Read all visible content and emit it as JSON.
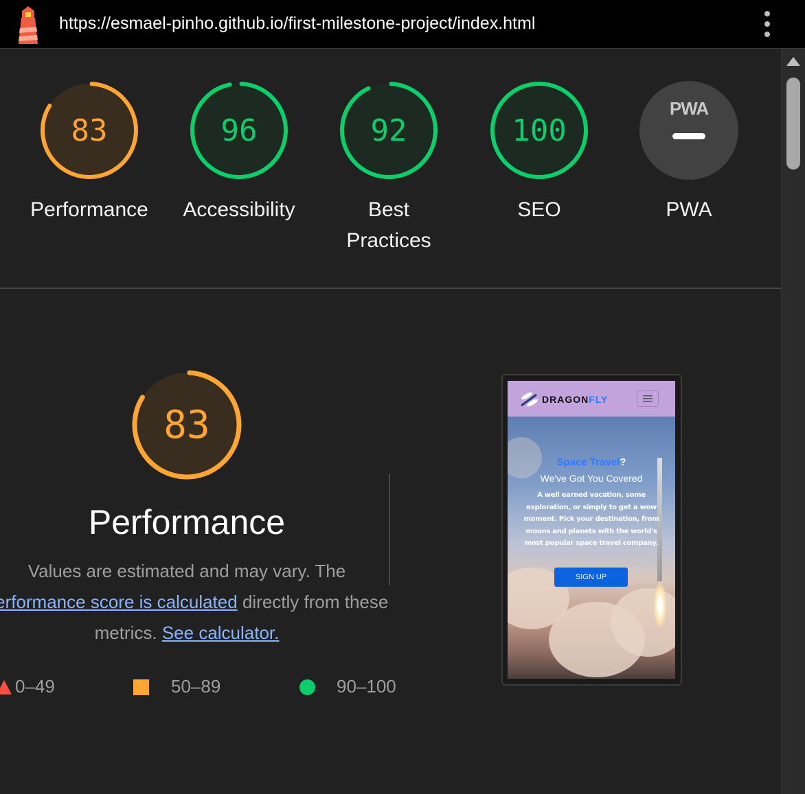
{
  "topbar": {
    "url": "https://esmael-pinho.github.io/first-milestone-project/index.html",
    "logo_icon": "lighthouse-icon",
    "menu_icon": "kebab-menu-icon"
  },
  "gauges": [
    {
      "label": "Performance",
      "score": "83",
      "status": "average"
    },
    {
      "label": "Accessibility",
      "score": "96",
      "status": "pass"
    },
    {
      "label_line1": "Best",
      "label_line2": "Practices",
      "score": "92",
      "status": "pass"
    },
    {
      "label": "SEO",
      "score": "100",
      "status": "pass"
    },
    {
      "label": "PWA",
      "badge": "PWA",
      "score": "—",
      "status": "na"
    }
  ],
  "performance": {
    "score": "83",
    "title": "Performance",
    "desc_part1": "Values are estimated and may vary. The",
    "desc_link1": "performance score is calculated",
    "desc_part2": "directly from these metrics.",
    "desc_link2": "See calculator."
  },
  "legend": [
    {
      "range": "0–49",
      "color": "#ff4e42"
    },
    {
      "range": "50–89",
      "color": "#ffa534"
    },
    {
      "range": "90–100",
      "color": "#0cce6b"
    }
  ],
  "thumbnail": {
    "brand_a": "DRAGON",
    "brand_b": "FLY",
    "headline": "Space Travel",
    "headline_q": "?",
    "subhead": "We've Got You Covered",
    "body": "A well earned vacation, some exploration, or simply to get a wow moment. Pick your destination, from moons and planets with the world's most popular space travel company.",
    "cta": "SIGN UP"
  },
  "colors": {
    "average": "#ffa534",
    "pass": "#0cce6b",
    "na": "#9e9e9e",
    "background": "#212121"
  }
}
